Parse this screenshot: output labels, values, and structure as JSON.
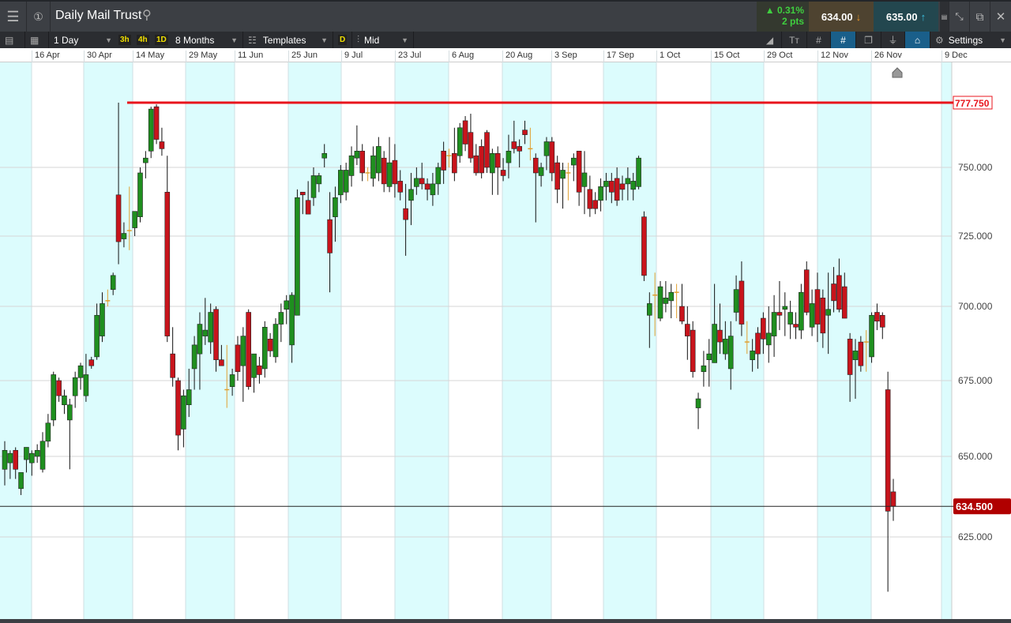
{
  "header": {
    "title": "Daily Mail Trust",
    "change_pct": "▲ 0.31%",
    "change_pts": "2 pts",
    "sell": "634.00",
    "buy": "635.00"
  },
  "toolbar": {
    "interval": "1 Day",
    "q3h": "3h",
    "q4h": "4h",
    "q1d": "1D",
    "range": "8 Months",
    "templates": "Templates",
    "d": "D",
    "price_type": "Mid",
    "settings": "Settings"
  },
  "colors": {
    "up": "#1f8f1f",
    "down": "#c8141c",
    "flat": "#e0a030",
    "hline": "#e8141c",
    "band": "#dcfcfd",
    "label_current": "#b00000"
  },
  "chart_data": {
    "type": "candlestick",
    "x_tick_labels": [
      "16 Apr",
      "30 Apr",
      "14 May",
      "29 May",
      "11 Jun",
      "25 Jun",
      "9 Jul",
      "23 Jul",
      "6 Aug",
      "20 Aug",
      "3 Sep",
      "17 Sep",
      "1 Oct",
      "15 Oct",
      "29 Oct",
      "12 Nov",
      "26 Nov",
      "9 Dec"
    ],
    "y_ticks": [
      "750.000",
      "725.000",
      "700.000",
      "675.000",
      "650.000",
      "625.000"
    ],
    "y_tick_values": [
      750,
      725,
      700,
      675,
      650,
      625
    ],
    "horizontal_line": {
      "value": 777.75,
      "label": "777.750"
    },
    "current_price": {
      "value": 634.5,
      "label": "634.500"
    },
    "ohlc": [
      [
        646,
        655,
        641,
        652
      ],
      [
        648,
        652,
        643,
        651
      ],
      [
        652,
        653,
        643,
        646
      ],
      [
        640,
        645,
        638,
        645
      ],
      [
        649,
        653,
        645,
        653
      ],
      [
        648,
        652,
        644,
        651
      ],
      [
        650,
        654,
        648,
        652
      ],
      [
        646,
        658,
        645,
        655
      ],
      [
        655,
        664,
        653,
        661
      ],
      [
        662,
        678,
        660,
        677
      ],
      [
        675,
        676,
        668,
        670
      ],
      [
        667,
        672,
        664,
        670
      ],
      [
        662,
        669,
        646,
        667
      ],
      [
        670,
        678,
        666,
        676
      ],
      [
        676,
        681,
        672,
        680
      ],
      [
        670,
        684,
        668,
        677
      ],
      [
        682,
        683,
        679,
        680
      ],
      [
        683,
        701,
        682,
        697
      ],
      [
        690,
        705,
        688,
        701
      ],
      [
        702,
        706,
        700,
        702
      ],
      [
        706,
        712,
        704,
        711
      ],
      [
        740,
        777.75,
        715,
        723
      ],
      [
        724,
        730,
        721,
        726
      ],
      [
        727,
        743,
        720,
        727
      ],
      [
        728,
        733,
        725,
        734
      ],
      [
        732,
        750,
        730,
        748
      ],
      [
        752,
        757,
        746,
        754
      ],
      [
        757,
        776,
        754,
        775
      ],
      [
        776,
        777,
        760,
        762
      ],
      [
        761,
        767,
        755,
        758
      ],
      [
        741,
        755,
        688,
        690
      ],
      [
        684,
        693,
        673,
        676
      ],
      [
        675,
        676,
        652,
        657
      ],
      [
        659,
        672,
        653,
        670
      ],
      [
        667,
        679,
        663,
        672
      ],
      [
        679,
        690,
        672,
        687
      ],
      [
        684,
        698,
        672,
        694
      ],
      [
        690,
        703,
        687,
        692
      ],
      [
        688,
        701,
        684,
        698
      ],
      [
        699,
        700,
        678,
        682
      ],
      [
        682,
        687,
        680,
        680
      ],
      [
        672,
        687,
        666,
        672
      ],
      [
        673,
        679,
        670,
        677
      ],
      [
        687,
        690,
        675,
        678
      ],
      [
        680,
        693,
        668,
        690
      ],
      [
        698,
        699,
        672,
        673
      ],
      [
        676,
        684,
        671,
        684
      ],
      [
        680,
        683,
        674,
        677
      ],
      [
        679,
        695,
        676,
        693
      ],
      [
        689,
        691,
        683,
        685
      ],
      [
        683,
        696,
        681,
        694
      ],
      [
        694,
        701,
        688,
        698
      ],
      [
        699,
        704,
        694,
        702
      ],
      [
        687,
        705,
        681,
        704
      ],
      [
        697,
        742,
        697,
        739
      ],
      [
        741,
        741,
        733,
        740
      ],
      [
        738,
        745,
        735,
        733
      ],
      [
        739,
        750,
        736,
        747
      ],
      [
        744,
        748,
        741,
        747
      ],
      [
        754,
        760,
        750,
        756
      ],
      [
        731,
        741,
        705,
        719
      ],
      [
        732,
        743,
        723,
        739
      ],
      [
        740,
        751,
        737,
        749
      ],
      [
        741,
        752,
        738,
        749
      ],
      [
        747,
        759,
        743,
        755
      ],
      [
        754,
        768,
        751,
        757
      ],
      [
        757,
        760,
        745,
        748
      ],
      [
        748,
        750,
        745,
        748
      ],
      [
        746,
        759,
        743,
        755
      ],
      [
        748,
        763,
        745,
        759
      ],
      [
        754,
        757,
        741,
        744
      ],
      [
        743,
        763,
        741,
        752
      ],
      [
        753,
        760,
        739,
        744
      ],
      [
        745,
        749,
        738,
        741
      ],
      [
        735,
        744,
        718,
        731
      ],
      [
        738,
        748,
        729,
        742
      ],
      [
        743,
        750,
        740,
        746
      ],
      [
        746,
        752,
        742,
        744
      ],
      [
        744,
        746,
        738,
        742
      ],
      [
        740,
        748,
        736,
        744
      ],
      [
        744,
        752,
        740,
        750
      ],
      [
        757,
        761,
        744,
        749
      ],
      [
        755,
        758,
        750,
        755
      ],
      [
        756,
        767,
        745,
        748
      ],
      [
        755,
        769,
        752,
        767
      ],
      [
        770,
        772,
        757,
        760
      ],
      [
        765,
        773,
        752,
        754
      ],
      [
        755,
        760,
        747,
        748
      ],
      [
        759,
        762,
        746,
        748
      ],
      [
        765,
        766,
        748,
        750
      ],
      [
        748,
        758,
        740,
        756
      ],
      [
        756,
        759,
        740,
        750
      ],
      [
        749,
        754,
        745,
        747
      ],
      [
        752,
        764,
        746,
        757
      ],
      [
        761,
        770,
        756,
        758
      ],
      [
        759,
        762,
        750,
        757
      ],
      [
        766,
        770,
        760,
        764
      ],
      [
        758,
        767,
        753,
        758
      ],
      [
        754,
        756,
        730,
        748
      ],
      [
        747,
        752,
        743,
        750
      ],
      [
        755,
        763,
        749,
        761
      ],
      [
        761,
        763,
        745,
        748
      ],
      [
        752,
        755,
        737,
        742
      ],
      [
        746,
        752,
        735,
        749
      ],
      [
        748,
        752,
        738,
        748
      ],
      [
        751,
        756,
        745,
        754
      ],
      [
        757,
        757,
        736,
        741
      ],
      [
        743,
        757,
        733,
        748
      ],
      [
        742,
        747,
        732,
        735
      ],
      [
        738,
        741,
        733,
        735
      ],
      [
        738,
        746,
        734,
        743
      ],
      [
        743,
        748,
        738,
        745
      ],
      [
        745,
        748,
        737,
        741
      ],
      [
        746,
        750,
        736,
        738
      ],
      [
        744,
        747,
        738,
        742
      ],
      [
        744,
        750,
        738,
        746
      ],
      [
        742,
        748,
        738,
        745
      ],
      [
        743,
        755,
        742,
        754
      ],
      [
        732,
        734,
        709,
        711
      ],
      [
        697,
        705,
        686,
        701
      ],
      [
        704,
        712,
        690,
        704
      ],
      [
        696,
        709,
        695,
        707
      ],
      [
        701,
        709,
        698,
        703
      ],
      [
        702,
        708,
        696,
        705
      ],
      [
        705,
        708,
        696,
        705
      ],
      [
        700,
        708,
        694,
        695
      ],
      [
        694,
        700,
        682,
        690
      ],
      [
        692,
        695,
        676,
        678
      ],
      [
        666,
        671,
        659,
        669
      ],
      [
        678,
        685,
        673,
        680
      ],
      [
        682,
        689,
        673,
        684
      ],
      [
        681,
        708,
        681,
        694
      ],
      [
        692,
        701,
        684,
        688
      ],
      [
        684,
        695,
        682,
        689
      ],
      [
        679,
        695,
        672,
        690
      ],
      [
        698,
        711,
        695,
        706
      ],
      [
        709,
        716,
        690,
        694
      ],
      [
        688,
        695,
        684,
        688
      ],
      [
        682,
        689,
        678,
        685
      ],
      [
        691,
        693,
        679,
        684
      ],
      [
        696,
        698,
        684,
        689
      ],
      [
        687,
        700,
        681,
        691
      ],
      [
        690,
        704,
        683,
        698
      ],
      [
        698,
        709,
        692,
        697
      ],
      [
        699,
        705,
        690,
        700
      ],
      [
        694,
        702,
        689,
        698
      ],
      [
        694,
        698,
        689,
        693
      ],
      [
        692,
        708,
        689,
        705
      ],
      [
        713,
        716,
        697,
        698
      ],
      [
        693,
        706,
        690,
        701
      ],
      [
        706,
        712,
        688,
        694
      ],
      [
        703,
        706,
        686,
        691
      ],
      [
        697,
        712,
        684,
        699
      ],
      [
        708,
        714,
        698,
        702
      ],
      [
        711,
        717,
        698,
        699
      ],
      [
        707,
        712,
        696,
        696
      ],
      [
        689,
        691,
        668,
        677
      ],
      [
        682,
        689,
        669,
        685
      ],
      [
        688,
        690,
        678,
        680
      ],
      [
        688,
        692,
        678,
        688
      ],
      [
        683,
        698,
        681,
        697
      ],
      [
        698,
        701,
        692,
        695
      ],
      [
        697,
        698,
        689,
        693
      ],
      [
        672,
        678,
        608,
        633
      ],
      [
        639,
        643,
        630,
        634.5
      ]
    ]
  }
}
